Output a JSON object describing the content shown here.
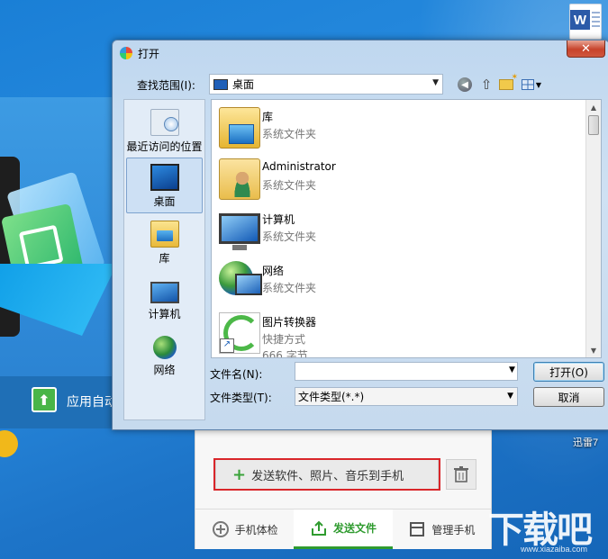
{
  "desktop": {
    "word_icon_letter": "W",
    "xunlei_label": "迅雷7"
  },
  "app_left": {
    "auto_button_label": "应用自动"
  },
  "phone_panel": {
    "send_button_label": "发送软件、照片、音乐到手机",
    "tabs": [
      {
        "label": "手机体检",
        "icon": "health-check-icon"
      },
      {
        "label": "发送文件",
        "icon": "send-file-icon",
        "active": true
      },
      {
        "label": "管理手机",
        "icon": "manage-phone-icon"
      }
    ]
  },
  "watermark": {
    "text": "下载吧",
    "url": "www.xiazaiba.com"
  },
  "dialog": {
    "title": "打开",
    "close_symbol": "✕",
    "look_in_label": "查找范围(I):",
    "look_in_value": "桌面",
    "places": [
      {
        "label": "最近访问的位置",
        "icon": "recent-places-icon"
      },
      {
        "label": "桌面",
        "icon": "desktop-icon",
        "selected": true
      },
      {
        "label": "库",
        "icon": "library-icon"
      },
      {
        "label": "计算机",
        "icon": "computer-icon"
      },
      {
        "label": "网络",
        "icon": "network-icon"
      }
    ],
    "files": [
      {
        "name": "库",
        "type": "系统文件夹",
        "icon": "library-folder-icon"
      },
      {
        "name": "Administrator",
        "type": "系统文件夹",
        "icon": "user-folder-icon"
      },
      {
        "name": "计算机",
        "type": "系统文件夹",
        "icon": "computer-icon"
      },
      {
        "name": "网络",
        "type": "系统文件夹",
        "icon": "network-icon"
      },
      {
        "name": "图片转换器",
        "type": "快捷方式",
        "size": "666 字节",
        "icon": "shortcut-icon"
      }
    ],
    "filename_label": "文件名(N):",
    "filename_value": "",
    "filetype_label": "文件类型(T):",
    "filetype_value": "文件类型(*.*)",
    "open_button": "打开(O)",
    "cancel_button": "取消"
  }
}
